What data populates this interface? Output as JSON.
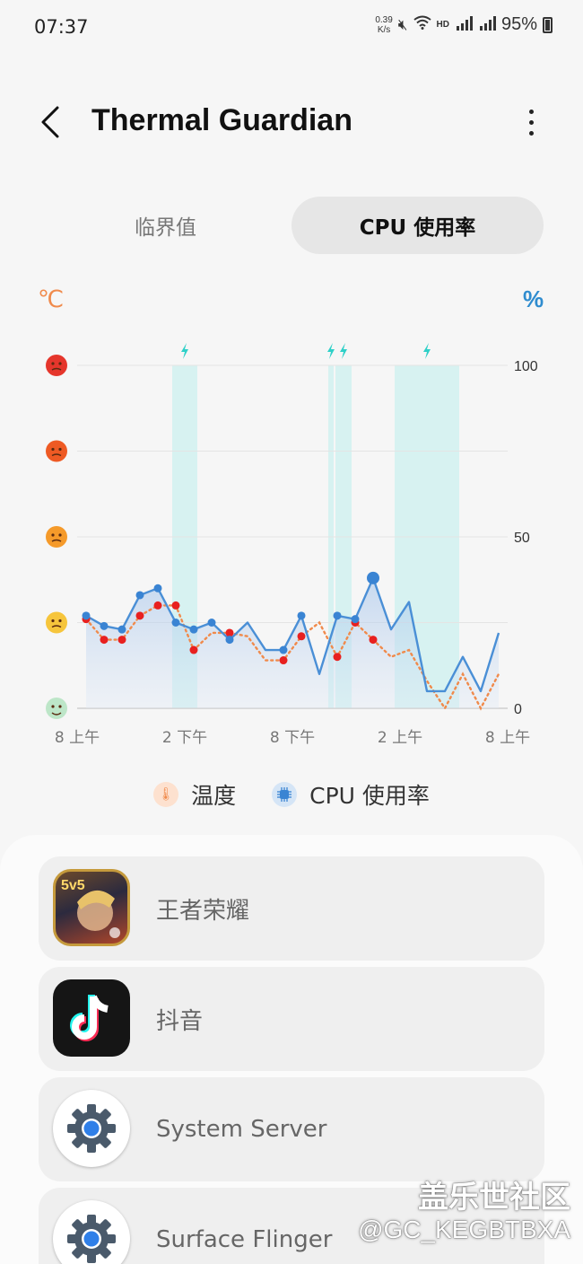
{
  "status_bar": {
    "time": "07:37",
    "net_speed_value": "0.39",
    "net_speed_unit": "K/s",
    "battery": "95%"
  },
  "header": {
    "title": "Thermal Guardian"
  },
  "tabs": [
    {
      "label": "临界值",
      "selected": false
    },
    {
      "label": "CPU 使用率",
      "selected": true
    }
  ],
  "chart_data": {
    "type": "line",
    "left_unit": "℃",
    "right_unit": "%",
    "y_ticks": [
      "100",
      "50",
      "0"
    ],
    "ylim": [
      0,
      100
    ],
    "x_tick_labels": [
      "8 上午",
      "2 下午",
      "8 下午",
      "2 上午",
      "8 上午"
    ],
    "x_range_hours": [
      0,
      24
    ],
    "series": [
      {
        "name": "CPU 使用率",
        "color": "#4a8fd6",
        "points": [
          [
            0.5,
            27
          ],
          [
            1.5,
            24
          ],
          [
            2.5,
            23
          ],
          [
            3.5,
            33
          ],
          [
            4.5,
            35
          ],
          [
            5.5,
            25
          ],
          [
            6.5,
            23
          ],
          [
            7.5,
            25
          ],
          [
            8.5,
            20
          ],
          [
            9.5,
            25
          ],
          [
            10.5,
            17
          ],
          [
            11.5,
            17
          ],
          [
            12.5,
            27
          ],
          [
            13.5,
            10
          ],
          [
            14.5,
            27
          ],
          [
            15.5,
            26
          ],
          [
            16.5,
            38
          ],
          [
            17.5,
            23
          ],
          [
            18.5,
            31
          ],
          [
            19.5,
            5
          ],
          [
            20.5,
            5
          ],
          [
            21.5,
            15
          ],
          [
            22.5,
            5
          ],
          [
            23.5,
            22
          ]
        ],
        "markers_x": [
          0.5,
          1.5,
          2.5,
          3.5,
          4.5,
          5.5,
          6.5,
          7.5,
          8.5,
          11.5,
          12.5,
          14.5,
          15.5,
          16.5
        ]
      },
      {
        "name": "温度",
        "color": "#f08a4b",
        "points": [
          [
            0.5,
            26
          ],
          [
            1.5,
            20
          ],
          [
            2.5,
            20
          ],
          [
            3.5,
            27
          ],
          [
            4.5,
            30
          ],
          [
            5.5,
            30
          ],
          [
            6.5,
            17
          ],
          [
            7.5,
            22
          ],
          [
            8.5,
            22
          ],
          [
            9.5,
            21
          ],
          [
            10.5,
            14
          ],
          [
            11.5,
            14
          ],
          [
            12.5,
            21
          ],
          [
            13.5,
            25
          ],
          [
            14.5,
            15
          ],
          [
            15.5,
            25
          ],
          [
            16.5,
            20
          ],
          [
            17.5,
            15
          ],
          [
            18.5,
            17
          ],
          [
            19.5,
            8
          ],
          [
            20.5,
            0
          ],
          [
            21.5,
            10
          ],
          [
            22.5,
            0
          ],
          [
            23.5,
            10
          ]
        ],
        "markers_x": [
          0.5,
          1.5,
          2.5,
          3.5,
          4.5,
          5.5,
          6.5,
          8.5,
          11.5,
          12.5,
          14.5,
          15.5,
          16.5
        ]
      }
    ],
    "charging_periods_hours": [
      [
        5.3,
        6.7
      ],
      [
        14.0,
        14.3
      ],
      [
        14.4,
        15.3
      ],
      [
        17.7,
        21.3
      ]
    ],
    "temperature_levels": [
      "very-hot",
      "hot",
      "warm",
      "normal",
      "cool"
    ]
  },
  "legend": [
    {
      "label": "温度",
      "icon": "thermometer-icon"
    },
    {
      "label": "CPU 使用率",
      "icon": "cpu-chip-icon"
    }
  ],
  "apps": [
    {
      "name": "王者荣耀",
      "icon": "game-icon"
    },
    {
      "name": "抖音",
      "icon": "tiktok-icon"
    },
    {
      "name": "System Server",
      "icon": "settings-gear-icon"
    },
    {
      "name": "Surface Flinger",
      "icon": "settings-gear-icon"
    }
  ],
  "watermark": {
    "line1": "盖乐世社区",
    "line2": "@GC_KEGBTBXA"
  }
}
